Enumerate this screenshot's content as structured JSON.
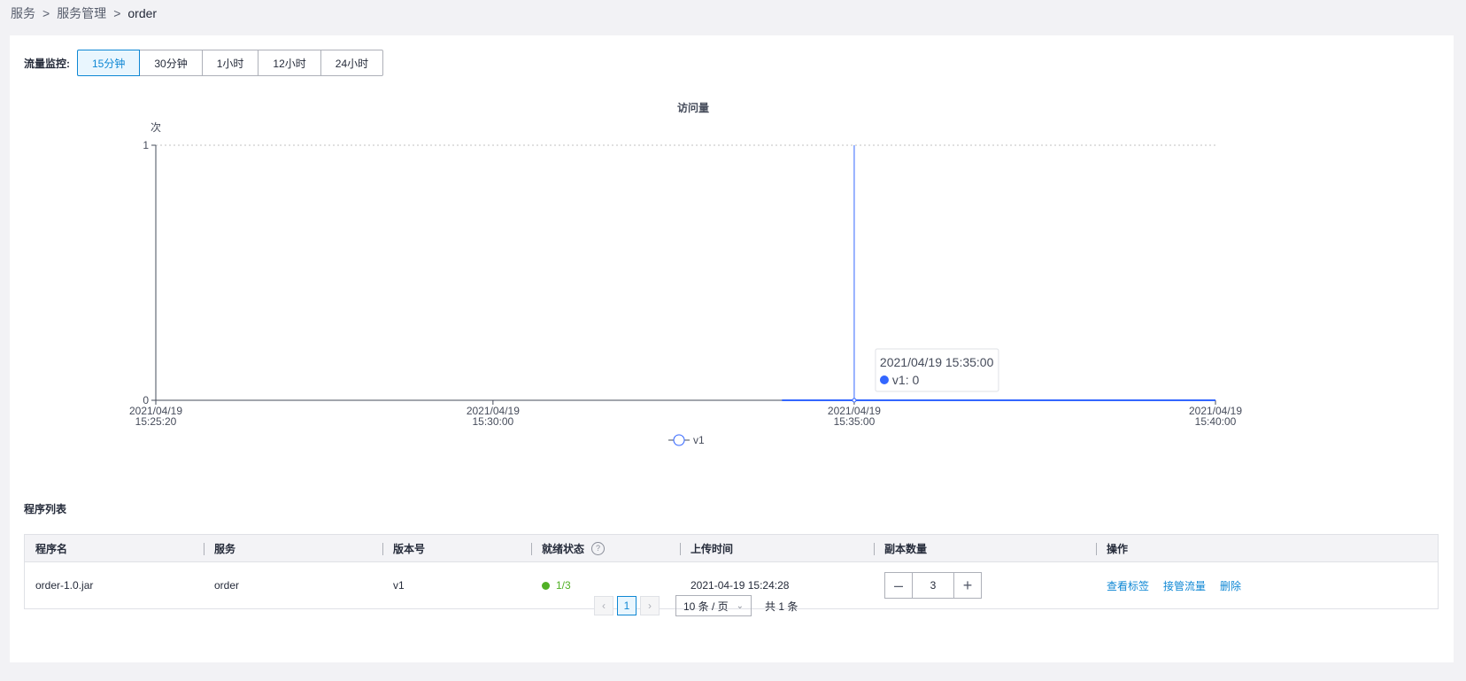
{
  "breadcrumb": [
    "服务",
    "服务管理",
    "order"
  ],
  "breadcrumb_sep": ">",
  "monitor": {
    "label": "流量监控:",
    "ranges": [
      "15分钟",
      "30分钟",
      "1小时",
      "12小时",
      "24小时"
    ],
    "active": 0
  },
  "chart_data": {
    "type": "line",
    "title": "访问量",
    "ylabel": "次",
    "ylim": [
      0,
      1
    ],
    "yticks": [
      "0",
      "1"
    ],
    "xticks": [
      {
        "date": "2021/04/19",
        "time": "15:25:20"
      },
      {
        "date": "2021/04/19",
        "time": "15:30:00"
      },
      {
        "date": "2021/04/19",
        "time": "15:35:00"
      },
      {
        "date": "2021/04/19",
        "time": "15:40:00"
      }
    ],
    "series": [
      {
        "name": "v1",
        "x": [
          "2021/04/19 15:34:00",
          "2021/04/19 15:35:00",
          "2021/04/19 15:40:00"
        ],
        "y": [
          0,
          0,
          0
        ]
      }
    ],
    "tooltip": {
      "title": "2021/04/19 15:35:00",
      "series": "v1",
      "value": "0"
    },
    "legend": [
      "v1"
    ],
    "colors": {
      "series": "#3366ff",
      "cursor": "#3366ff"
    }
  },
  "program_list": {
    "title": "程序列表",
    "headers": [
      "程序名",
      "服务",
      "版本号",
      "就绪状态",
      "上传时间",
      "副本数量",
      "操作"
    ],
    "rows": [
      {
        "name": "order-1.0.jar",
        "service": "order",
        "version": "v1",
        "status": "1/3",
        "uploaded": "2021-04-19 15:24:28",
        "replicas": "3",
        "actions": [
          "查看标签",
          "接管流量",
          "删除"
        ]
      }
    ]
  },
  "pagination": {
    "current": "1",
    "page_size": "10 条 / 页",
    "total": "共 1 条"
  }
}
